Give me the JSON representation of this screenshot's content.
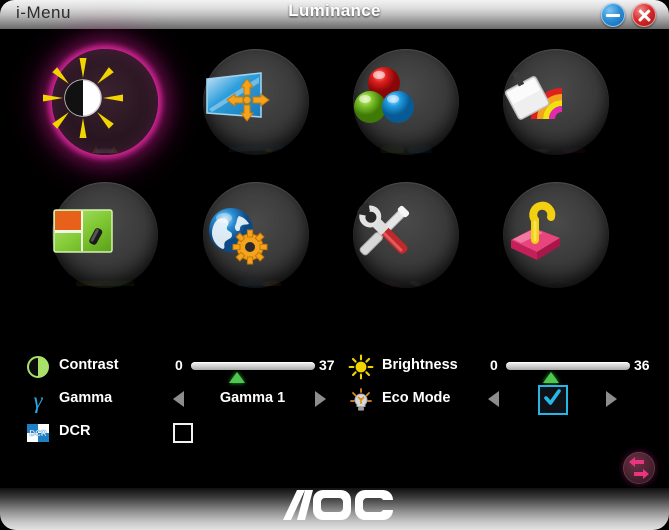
{
  "window": {
    "app_name": "i-Menu",
    "title": "Luminance",
    "minimize_label": "Minimize",
    "close_label": "Close"
  },
  "icon_grid": {
    "items": [
      {
        "id": "luminance",
        "icon": "sun-contrast-icon",
        "selected": true,
        "label": "Luminance"
      },
      {
        "id": "image-setup",
        "icon": "image-setup-icon",
        "selected": false,
        "label": "Image Setup"
      },
      {
        "id": "color-setup",
        "icon": "rgb-spheres-icon",
        "selected": false,
        "label": "Color Setup"
      },
      {
        "id": "picture-boost",
        "icon": "rainbow-card-icon",
        "selected": false,
        "label": "Picture Boost"
      },
      {
        "id": "osd-setup",
        "icon": "osd-window-icon",
        "selected": false,
        "label": "OSD Setup"
      },
      {
        "id": "language",
        "icon": "globe-gear-icon",
        "selected": false,
        "label": "Language"
      },
      {
        "id": "extra",
        "icon": "tools-icon",
        "selected": false,
        "label": "Extra"
      },
      {
        "id": "exit",
        "icon": "pink-box-hook-icon",
        "selected": false,
        "label": "Exit"
      }
    ]
  },
  "controls": {
    "contrast": {
      "icon": "contrast-circle-icon",
      "label": "Contrast",
      "min": "0",
      "max": "37",
      "value": 37,
      "percent": 37
    },
    "brightness": {
      "icon": "sun-icon",
      "label": "Brightness",
      "min": "0",
      "max": "36",
      "value": 36,
      "percent": 36
    },
    "gamma": {
      "icon": "gamma-icon",
      "label": "Gamma",
      "value": "Gamma 1",
      "prev": "◀",
      "next": "▶"
    },
    "eco_mode": {
      "icon": "eco-bulb-icon",
      "label": "Eco Mode",
      "checked": true,
      "prev": "◀",
      "next": "▶"
    },
    "dcr": {
      "icon": "dcr-icon",
      "label": "DCR",
      "checked": false
    }
  },
  "reset_badge": {
    "icon": "reset-arrows-icon",
    "label": "Reset"
  },
  "footer": {
    "brand": "AOC",
    "logo_icon": "aoc-logo-icon"
  },
  "colors": {
    "accent_selected_glow": "#e228a0",
    "slider_thumb": "#4cc94c",
    "checkbox_border_active": "#27b6e8",
    "titlebar_title": "#ffffff",
    "minimize_button": "#2b8ed6",
    "close_button": "#d62b2b"
  }
}
